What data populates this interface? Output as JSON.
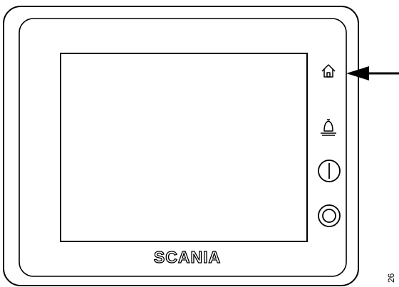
{
  "device": {
    "brand": "SCANIA",
    "reference_number": "26"
  },
  "side_buttons": [
    {
      "id": "home",
      "icon": "home-icon"
    },
    {
      "id": "alarm",
      "icon": "bell-icon"
    },
    {
      "id": "power",
      "icon": "power-icon"
    },
    {
      "id": "rotary",
      "icon": "knob-icon"
    }
  ],
  "callout": {
    "points_to": "home-button"
  }
}
